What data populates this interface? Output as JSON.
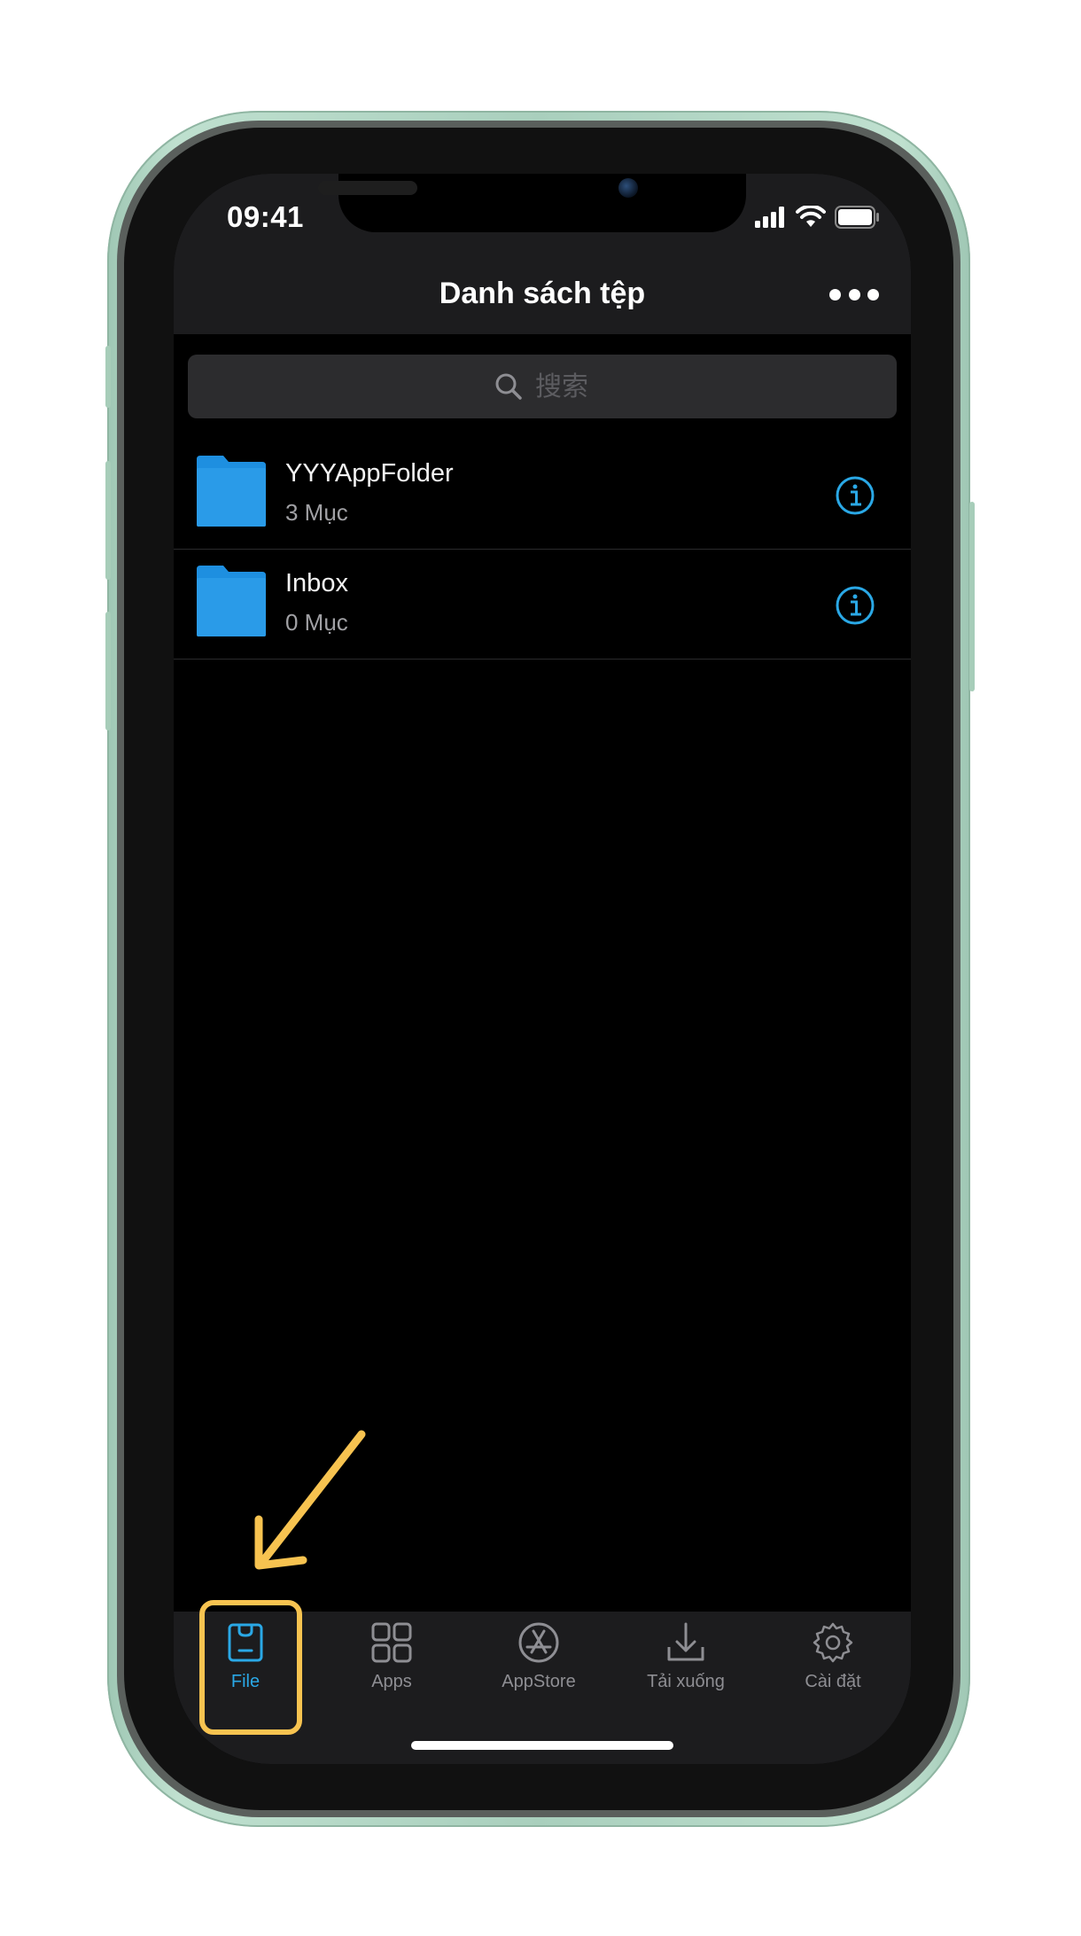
{
  "status_bar": {
    "time": "09:41"
  },
  "nav": {
    "title": "Danh sách tệp"
  },
  "search": {
    "placeholder": "搜索"
  },
  "files": [
    {
      "name": "YYYAppFolder",
      "count": "3 Mục"
    },
    {
      "name": "Inbox",
      "count": "0 Mục"
    }
  ],
  "tabs": [
    {
      "label": "File",
      "icon": "file-bag-icon",
      "active": true
    },
    {
      "label": "Apps",
      "icon": "apps-grid-icon",
      "active": false
    },
    {
      "label": "AppStore",
      "icon": "appstore-icon",
      "active": false
    },
    {
      "label": "Tải xuống",
      "icon": "download-icon",
      "active": false
    },
    {
      "label": "Cài đặt",
      "icon": "settings-gear-icon",
      "active": false
    }
  ],
  "colors": {
    "accent": "#2aa8e6",
    "folder": "#1e8fe0",
    "annotation": "#f7c350",
    "phone_frame": "#a9cfbd"
  }
}
